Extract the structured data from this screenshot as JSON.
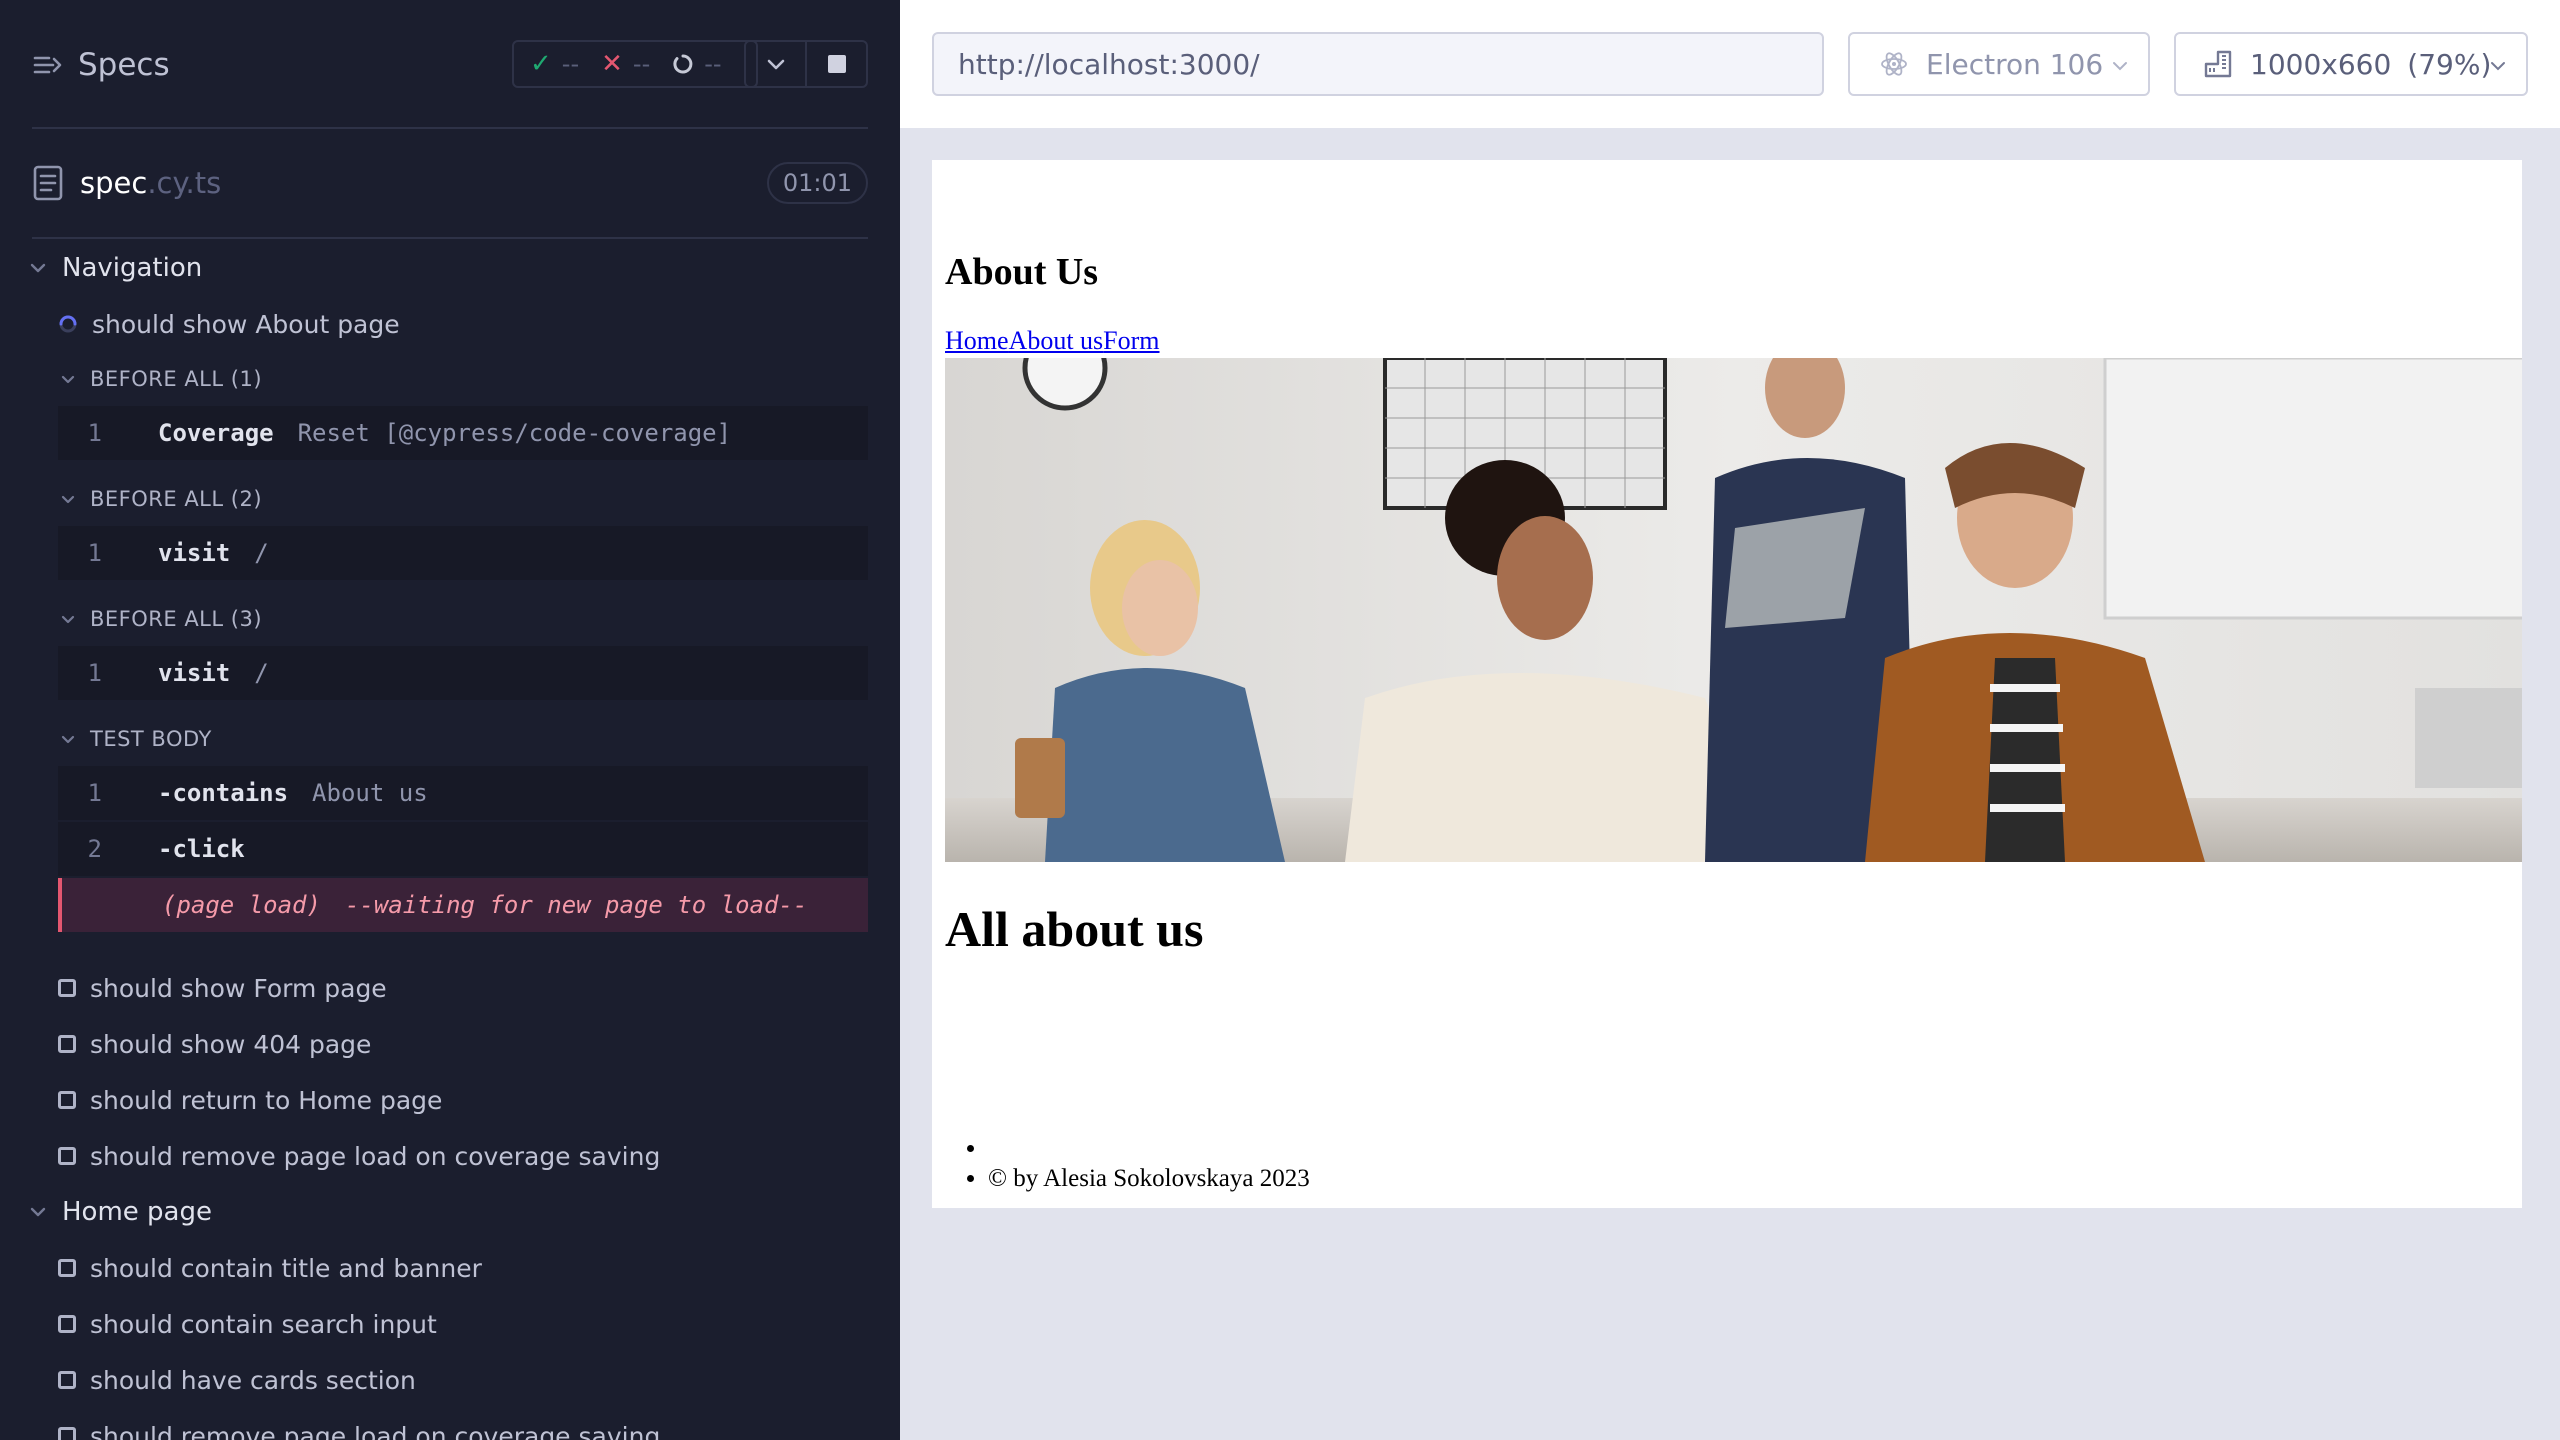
{
  "reporter": {
    "title": "Specs",
    "stats": {
      "passed": "--",
      "failed": "--",
      "pending": "--"
    },
    "spec": {
      "name": "spec",
      "ext": ".cy.ts",
      "duration": "01:01"
    },
    "suites": [
      {
        "title": "Navigation",
        "running_test": "should show About page",
        "hooks": [
          {
            "title": "BEFORE ALL (1)",
            "commands": [
              {
                "num": "1",
                "name": "Coverage",
                "message": "Reset [@cypress/code-coverage]"
              }
            ]
          },
          {
            "title": "BEFORE ALL (2)",
            "commands": [
              {
                "num": "1",
                "name": "visit",
                "message": "/"
              }
            ]
          },
          {
            "title": "BEFORE ALL (3)",
            "commands": [
              {
                "num": "1",
                "name": "visit",
                "message": "/"
              }
            ]
          },
          {
            "title": "TEST BODY",
            "commands": [
              {
                "num": "1",
                "name": "-contains",
                "message": "About us"
              },
              {
                "num": "2",
                "name": "-click",
                "message": ""
              }
            ]
          }
        ],
        "page_load": {
          "label": "(page load)",
          "message": "--waiting for new page to load--"
        },
        "tests": [
          "should show Form page",
          "should show 404 page",
          "should return to Home page",
          "should remove page load on coverage saving"
        ]
      },
      {
        "title": "Home page",
        "tests": [
          "should contain title and banner",
          "should contain search input",
          "should have cards section",
          "should remove page load on coverage saving"
        ]
      }
    ]
  },
  "preview": {
    "url": "http://localhost:3000/",
    "browser": "Electron 106",
    "viewport": "1000x660",
    "zoom": "(79%)",
    "app": {
      "heading": "About Us",
      "nav_links": [
        "Home",
        "About us",
        "Form"
      ],
      "banner_icon": "office-team-photo",
      "subheading": "All about us",
      "footer_items": [
        "",
        "© by Alesia Sokolovskaya 2023"
      ]
    }
  },
  "colors": {
    "reporter_bg": "#1b1e2e",
    "pass": "#1fa971",
    "fail": "#e45770",
    "running": "#6470f3",
    "page_load_bg": "#3a2238"
  }
}
